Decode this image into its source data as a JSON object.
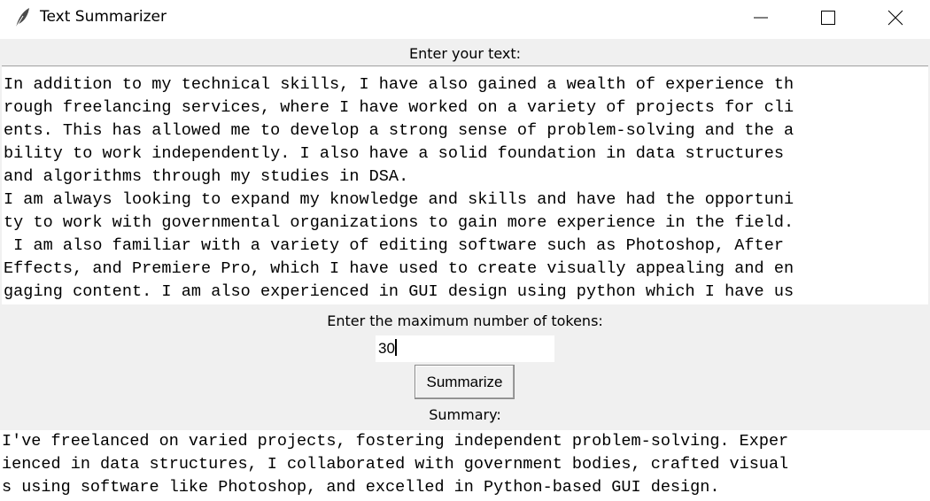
{
  "window": {
    "title": "Text Summarizer",
    "app_icon": "feather-icon",
    "controls": [
      "minimize-icon",
      "maximize-icon",
      "close-icon"
    ]
  },
  "input_section": {
    "label": "Enter your text:",
    "text_lines": [
      "In addition to my technical skills, I have also gained a wealth of experience th",
      "rough freelancing services, where I have worked on a variety of projects for cli",
      "ents. This has allowed me to develop a strong sense of problem-solving and the a",
      "bility to work independently. I also have a solid foundation in data structures",
      "and algorithms through my studies in DSA.",
      "I am always looking to expand my knowledge and skills and have had the opportuni",
      "ty to work with governmental organizations to gain more experience in the field.",
      " I am also familiar with a variety of editing software such as Photoshop, After",
      "Effects, and Premiere Pro, which I have used to create visually appealing and en",
      "gaging content. I am also experienced in GUI design using python which I have us"
    ]
  },
  "tokens": {
    "label": "Enter the maximum number of tokens:",
    "value": "30"
  },
  "summarize_button": {
    "label": "Summarize"
  },
  "summary_section": {
    "label": "Summary:",
    "text_lines": [
      "I've freelanced on varied projects, fostering independent problem-solving. Exper",
      "ienced in data structures, I collaborated with government bodies, crafted visual",
      "s using software like Photoshop, and excelled in Python-based GUI design."
    ]
  }
}
